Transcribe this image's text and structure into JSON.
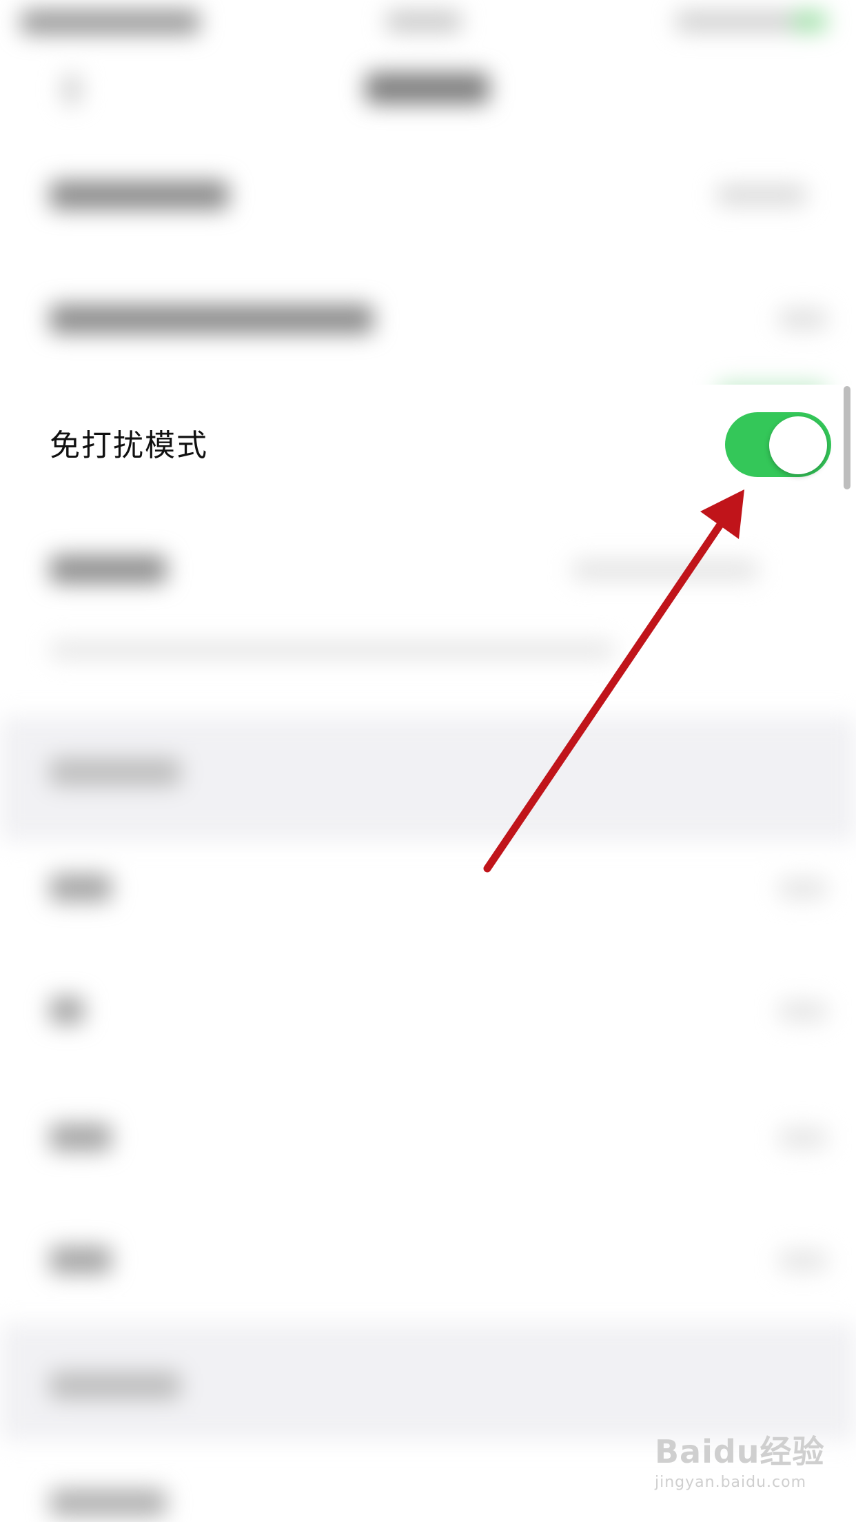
{
  "settings": {
    "dnd_row": {
      "label": "免打扰模式",
      "toggle_on": true,
      "toggle_color": "#34c759"
    }
  },
  "annotation": {
    "arrow_color": "#c0141a"
  },
  "watermark": {
    "brand": "Baidu经验",
    "url": "jingyan.baidu.com"
  }
}
